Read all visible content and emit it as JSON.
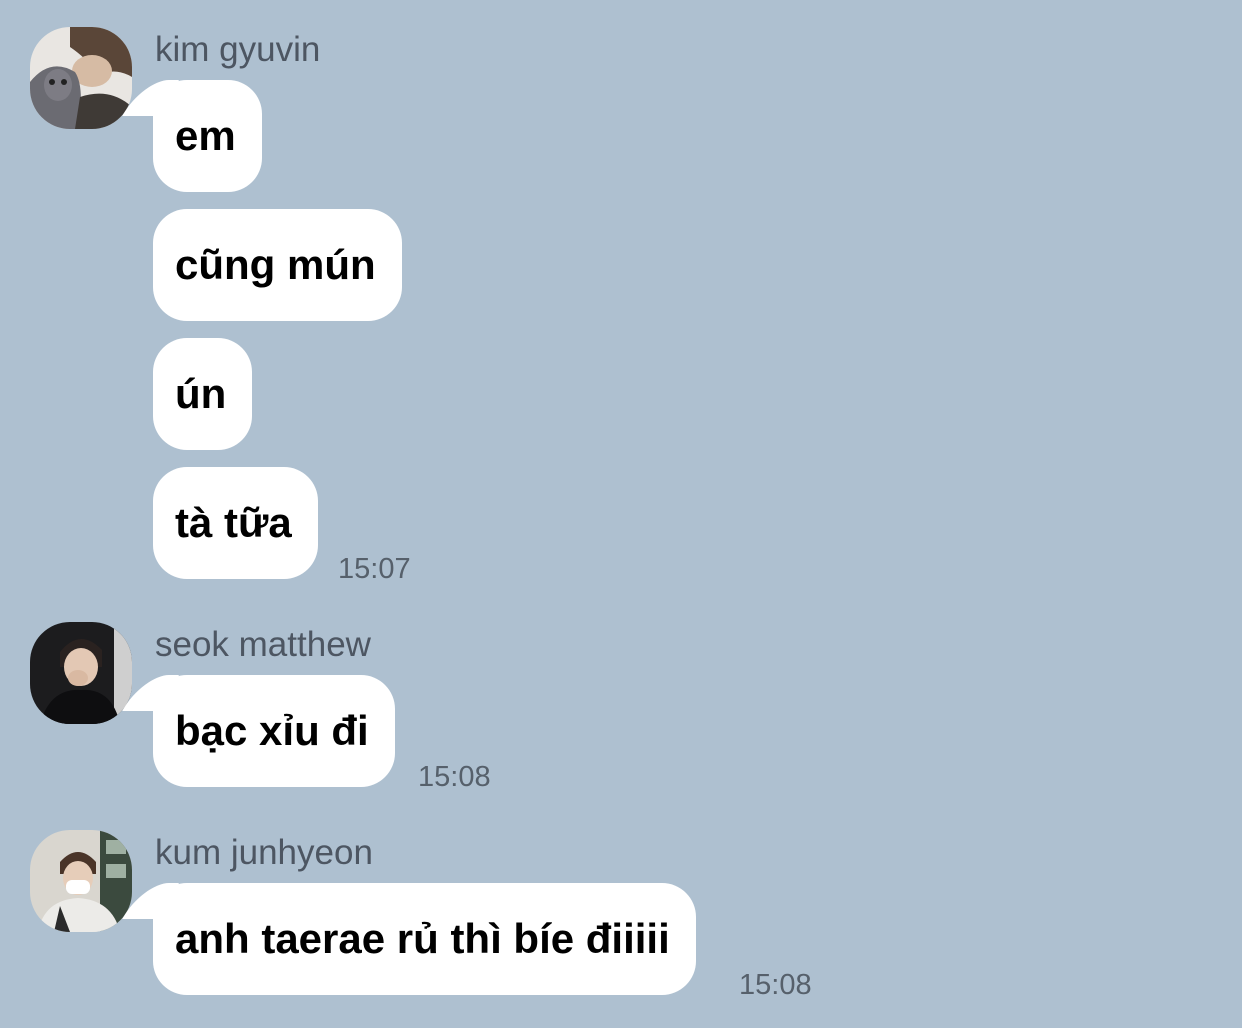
{
  "chat": {
    "groups": [
      {
        "sender": "kim gyuvin",
        "messages": [
          "em",
          "cũng mún",
          "ún",
          "tà tữa"
        ],
        "time": "15:07"
      },
      {
        "sender": "seok matthew",
        "messages": [
          "bạc xỉu đi"
        ],
        "time": "15:08"
      },
      {
        "sender": "kum junhyeon",
        "messages": [
          "anh taerae rủ thì bíe điiiii"
        ],
        "time": "15:08"
      }
    ]
  },
  "theme": {
    "background": "#aec0d0",
    "bubble": "#ffffff",
    "sender_text": "#4d5662",
    "time_text": "#56606b"
  }
}
